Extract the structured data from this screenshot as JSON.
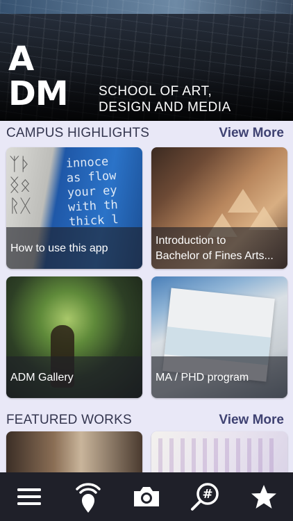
{
  "header": {
    "logo_line1": "A",
    "logo_line2": "DM",
    "school_line1": "SCHOOL OF ART,",
    "school_line2": "DESIGN AND MEDIA"
  },
  "campus_highlights": {
    "title": "CAMPUS HIGHLIGHTS",
    "view_more": "View More",
    "cards": [
      {
        "caption_line1": "How to use this app",
        "caption_line2": ""
      },
      {
        "caption_line1": "Introduction to",
        "caption_line2": "Bachelor of Fines Arts..."
      },
      {
        "caption_line1": "ADM Gallery",
        "caption_line2": ""
      },
      {
        "caption_line1": "MA / PHD program",
        "caption_line2": ""
      }
    ]
  },
  "featured_works": {
    "title": "FEATURED WORKS",
    "view_more": "View More"
  },
  "tabbar": {
    "items": [
      {
        "icon": "menu-icon"
      },
      {
        "icon": "location-beacon-icon"
      },
      {
        "icon": "camera-icon"
      },
      {
        "icon": "hashtag-search-icon"
      },
      {
        "icon": "star-icon"
      }
    ]
  },
  "colors": {
    "background": "#e9e8f7",
    "tabbar": "#1f2029",
    "view_more": "#3f4272",
    "section_title": "#34364f"
  }
}
